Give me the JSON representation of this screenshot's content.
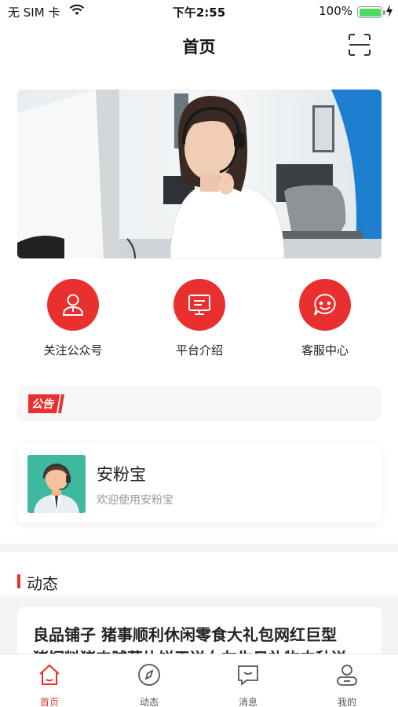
{
  "status_bar": {
    "carrier": "无 SIM 卡",
    "time": "下午2:55",
    "battery_pct": "100%",
    "battery_level": 1.0
  },
  "navbar": {
    "title": "首页"
  },
  "banner": {
    "page_count": 3,
    "active_index": 1
  },
  "quick_actions": [
    {
      "label": "关注公众号",
      "icon": "user-icon"
    },
    {
      "label": "平台介绍",
      "icon": "monitor-icon"
    },
    {
      "label": "客服中心",
      "icon": "chat-smile-icon"
    }
  ],
  "notice": {
    "tag": "公告",
    "text": ""
  },
  "service_card": {
    "name": "安粉宝",
    "subtitle": "欢迎使用安粉宝"
  },
  "dynamics": {
    "section_title": "动态",
    "items": [
      {
        "title_line1": "良品铺子 猪事顺利休闲零食大礼包网红巨型",
        "title_line2": "猪饲料猪肉脯薯片饼干送女友生日礼物中秋送"
      }
    ]
  },
  "tabbar": {
    "items": [
      {
        "label": "首页",
        "icon": "home-icon",
        "active": true
      },
      {
        "label": "动态",
        "icon": "compass-icon",
        "active": false
      },
      {
        "label": "消息",
        "icon": "message-icon",
        "active": false
      },
      {
        "label": "我的",
        "icon": "profile-icon",
        "active": false
      }
    ]
  },
  "colors": {
    "accent": "#ea2f2f",
    "battery": "#4cd964"
  }
}
